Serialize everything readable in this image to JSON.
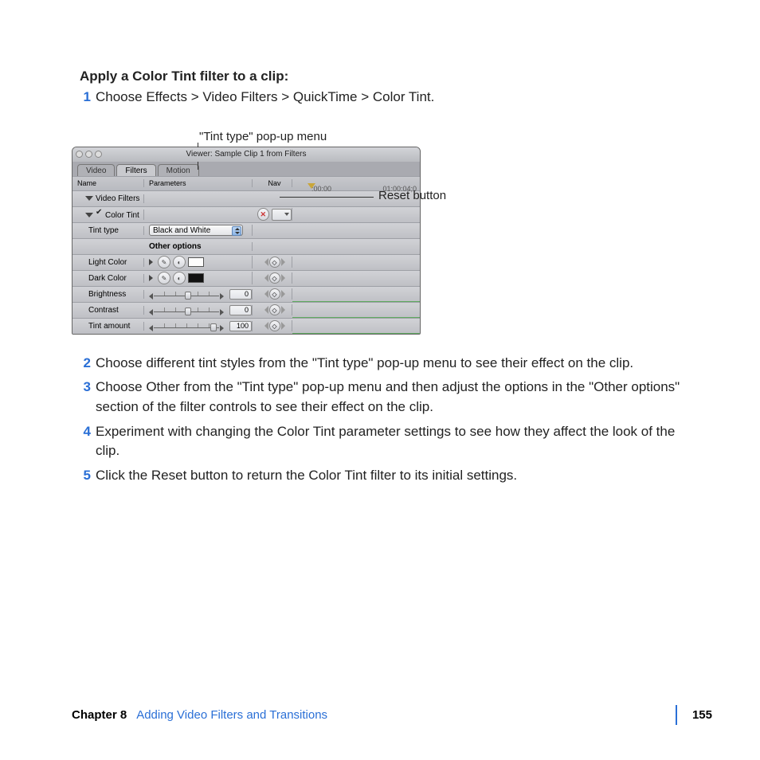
{
  "heading": "Apply a Color Tint filter to a clip:",
  "steps": {
    "1": "Choose Effects > Video Filters > QuickTime > Color Tint.",
    "2": "Choose different tint styles from the \"Tint type\" pop-up menu to see their effect on the clip.",
    "3": "Choose Other from the \"Tint type\" pop-up menu and then adjust the options in the \"Other options\" section of the filter controls to see their effect on the clip.",
    "4": "Experiment with changing the Color Tint parameter settings to see how they affect the look of the clip.",
    "5": "Click the Reset button to return the Color Tint filter to its initial settings."
  },
  "callouts": {
    "top": "\"Tint type\" pop-up menu",
    "right": "Reset button"
  },
  "window": {
    "title": "Viewer: Sample Clip 1 from Filters",
    "tabs": {
      "video": "Video",
      "filters": "Filters",
      "motion": "Motion"
    },
    "columns": {
      "name": "Name",
      "parameters": "Parameters",
      "nav": "Nav"
    },
    "timecodes": {
      "start": ":00:00",
      "end": "01:00:04;0"
    },
    "rows": {
      "video_filters": "Video Filters",
      "color_tint": "Color Tint",
      "tint_type": {
        "label": "Tint type",
        "value": "Black and White"
      },
      "other_options": "Other options",
      "light_color": "Light Color",
      "dark_color": "Dark Color",
      "brightness": {
        "label": "Brightness",
        "value": "0"
      },
      "contrast": {
        "label": "Contrast",
        "value": "0"
      },
      "tint_amount": {
        "label": "Tint amount",
        "value": "100"
      }
    }
  },
  "footer": {
    "chapter": "Chapter 8",
    "title": "Adding Video Filters and Transitions",
    "page": "155"
  }
}
